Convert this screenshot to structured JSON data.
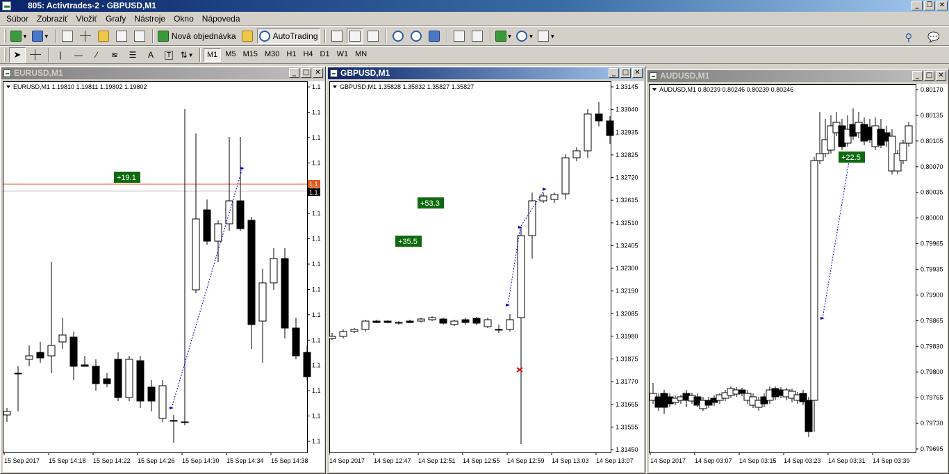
{
  "app": {
    "title": "805: Activtrades-2 - GBPUSD,M1"
  },
  "menu": {
    "items": [
      "Súbor",
      "Zobraziť",
      "Vložiť",
      "Grafy",
      "Nástroje",
      "Okno",
      "Nápoveda"
    ]
  },
  "toolbar": {
    "new_order_label": "Nová objednávka",
    "autotrading_label": "AutoTrading",
    "timeframes": [
      "M1",
      "M5",
      "M15",
      "M30",
      "H1",
      "H4",
      "D1",
      "W1",
      "MN"
    ],
    "active_timeframe": "M1",
    "text_tool_label": "A"
  },
  "charts": [
    {
      "window_title": "EURUSD,M1",
      "active": false,
      "info": "EURUSD,M1  1.19810 1.19811 1.19802 1.19802",
      "price_labels": [
        "1.1",
        "1.1",
        "1.1",
        "1.1",
        "1.1",
        "1.1",
        "1.1",
        "1.1",
        "1.1",
        "1.1",
        "1.1",
        "1.1",
        "1.1",
        "1.1",
        "1.1"
      ],
      "current_price_tag_1": "1.1",
      "current_price_tag_2": "1.1",
      "time_labels": [
        "15 Sep 2017",
        "15 Sep 14:18",
        "15 Sep 14:22",
        "15 Sep 14:26",
        "15 Sep 14:30",
        "15 Sep 14:34",
        "15 Sep 14:38"
      ],
      "profit_badges": [
        "+19.1"
      ]
    },
    {
      "window_title": "GBPUSD,M1",
      "active": true,
      "info": "GBPUSD,M1  1.35828 1.35832 1.35827 1.35827",
      "price_labels": [
        "1.33145",
        "1.33040",
        "1.32935",
        "1.32825",
        "1.32720",
        "1.32615",
        "1.32510",
        "1.32405",
        "1.32300",
        "1.32190",
        "1.32085",
        "1.31980",
        "1.31875",
        "1.31770",
        "1.31665",
        "1.31555",
        "1.31450"
      ],
      "time_labels": [
        "14 Sep 2017",
        "14 Sep 12:47",
        "14 Sep 12:51",
        "14 Sep 12:55",
        "14 Sep 12:59",
        "14 Sep 13:03",
        "14 Sep 13:07"
      ],
      "profit_badges": [
        "+53.3",
        "+35.5"
      ]
    },
    {
      "window_title": "AUDUSD,M1",
      "active": false,
      "info": "AUDUSD,M1  0.80239 0.80246 0.80239 0.80246",
      "price_labels": [
        "0.80170",
        "0.80135",
        "0.80105",
        "0.80070",
        "0.80035",
        "0.80000",
        "0.79965",
        "0.79935",
        "0.79900",
        "0.79865",
        "0.79830",
        "0.79800",
        "0.79765",
        "0.79730",
        "0.79695"
      ],
      "time_labels": [
        "14 Sep 2017",
        "14 Sep 03:07",
        "14 Sep 03:15",
        "14 Sep 03:23",
        "14 Sep 03:31",
        "14 Sep 03:39"
      ],
      "profit_badges": [
        "+22.5"
      ]
    }
  ],
  "colors": {
    "badge_green": "#0e6a0e",
    "bid_line": "#e05a1e",
    "trade_line": "#0000cc",
    "title_active": "#0a246a"
  }
}
